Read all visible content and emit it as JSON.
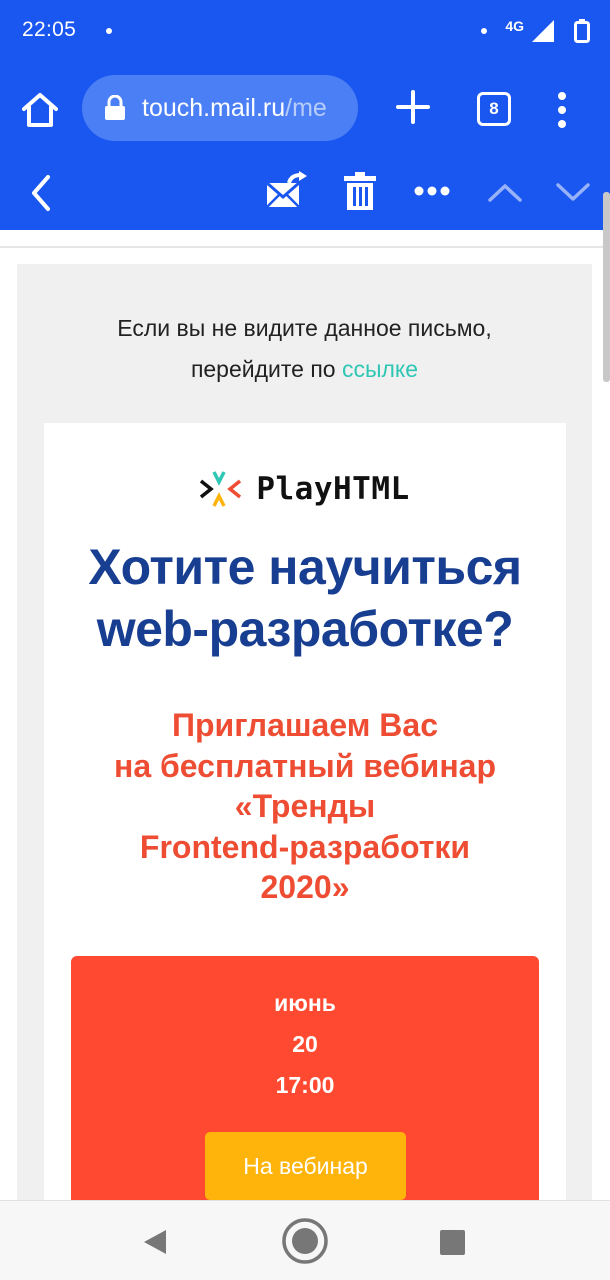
{
  "status_bar": {
    "time": "22:05",
    "network": "4G"
  },
  "browser": {
    "url_host": "touch.mail.ru",
    "url_path": "/me",
    "tab_count": "8"
  },
  "email": {
    "notice_line1": "Если вы не видите данное письмо,",
    "notice_line2_prefix": "перейдите по ",
    "notice_link": "ссылке",
    "logo_text": "PlayHTML",
    "headline_line1": "Хотите научиться",
    "headline_line2": "web-разработке?",
    "subhead_lines": [
      "Приглашаем Вас",
      "на бесплатный вебинар",
      "«Тренды",
      "Frontend-разработки",
      "2020»"
    ],
    "event_month": "июнь",
    "event_day": "20",
    "event_time": "17:00",
    "cta_label": "На вебинар"
  },
  "colors": {
    "toolbar_blue": "#1a56f0",
    "headline_blue": "#173e91",
    "accent_red": "#ee4d33",
    "event_box": "#ff4a31",
    "cta_yellow": "#ffb40c",
    "link_teal": "#2dc7b4"
  },
  "icons": {
    "home": "home-icon",
    "lock": "lock-icon",
    "new_tab": "plus-icon",
    "more": "more-vertical-icon",
    "back": "chevron-left-icon",
    "move": "move-mail-icon",
    "delete": "trash-icon",
    "more_actions": "more-horizontal-icon",
    "prev": "chevron-up-icon",
    "next": "chevron-down-icon",
    "nav_back": "triangle-back-icon",
    "nav_home": "circle-home-icon",
    "nav_recent": "square-recent-icon"
  }
}
